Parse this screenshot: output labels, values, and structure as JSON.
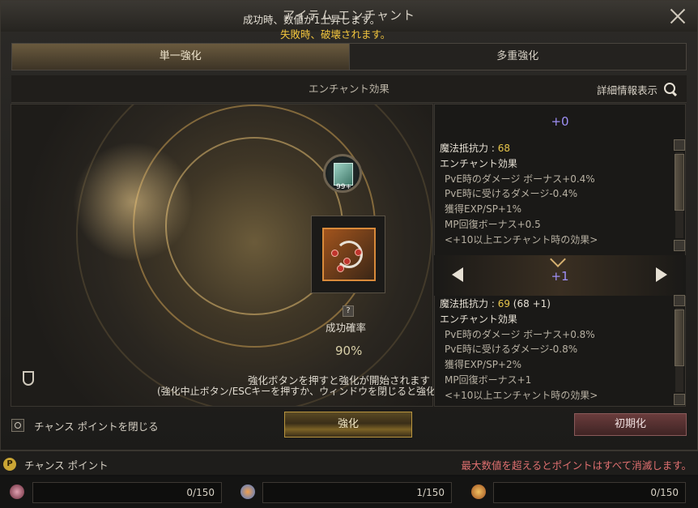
{
  "window": {
    "title": "アイテム エンチャント"
  },
  "tabs": [
    {
      "label": "単一強化",
      "active": true
    },
    {
      "label": "多重強化",
      "active": false
    }
  ],
  "subheader": {
    "title": "エンチャント効果",
    "detail_label": "詳細情報表示"
  },
  "stage": {
    "msg_success": "成功時、数値が1上昇します。",
    "msg_fail": "失敗時、破壊されます。",
    "scroll_count": "99+",
    "rate_label": "成功確率",
    "rate_value": "90%",
    "note_line1": "強化ボタンを押すと強化が開始されます",
    "note_line2": "(強化中止ボタン/ESCキーを押すか、ウィンドウを閉じると強化"
  },
  "current": {
    "level": "+0",
    "stat_label": "魔法抵抗力 :",
    "stat_value": "68",
    "effect_title": "エンチャント効果",
    "effects": [
      "PvE時のダメージ ボーナス+0.4%",
      "PvE時に受けるダメージ-0.4%",
      "獲得EXP/SP+1%",
      "MP回復ボーナス+0.5",
      "<+10以上エンチャント時の効果>"
    ]
  },
  "next": {
    "level": "+1",
    "stat_label": "魔法抵抗力 :",
    "stat_value": "69",
    "stat_diff": "(68 +1)",
    "effect_title": "エンチャント効果",
    "effects": [
      "PvE時のダメージ ボーナス+0.8%",
      "PvE時に受けるダメージ-0.8%",
      "獲得EXP/SP+2%",
      "MP回復ボーナス+1",
      "<+10以上エンチャント時の効果>"
    ]
  },
  "bottom": {
    "close_chance_label": "チャンス ポイントを閉じる",
    "enchant_label": "強化",
    "reset_label": "初期化"
  },
  "points": {
    "icon_letter": "P",
    "label": "チャンス ポイント",
    "warning": "最大数値を超えるとポイントはすべて消滅します。"
  },
  "counters": [
    {
      "value": "0/150",
      "icon": "gem-icon"
    },
    {
      "value": "1/150",
      "icon": "orb-icon"
    },
    {
      "value": "0/150",
      "icon": "emblem-icon"
    }
  ],
  "colors": {
    "level": "#9e8ff5",
    "highlight": "#e8c64b",
    "fail": "#f2c53d",
    "warning": "#e07070"
  }
}
